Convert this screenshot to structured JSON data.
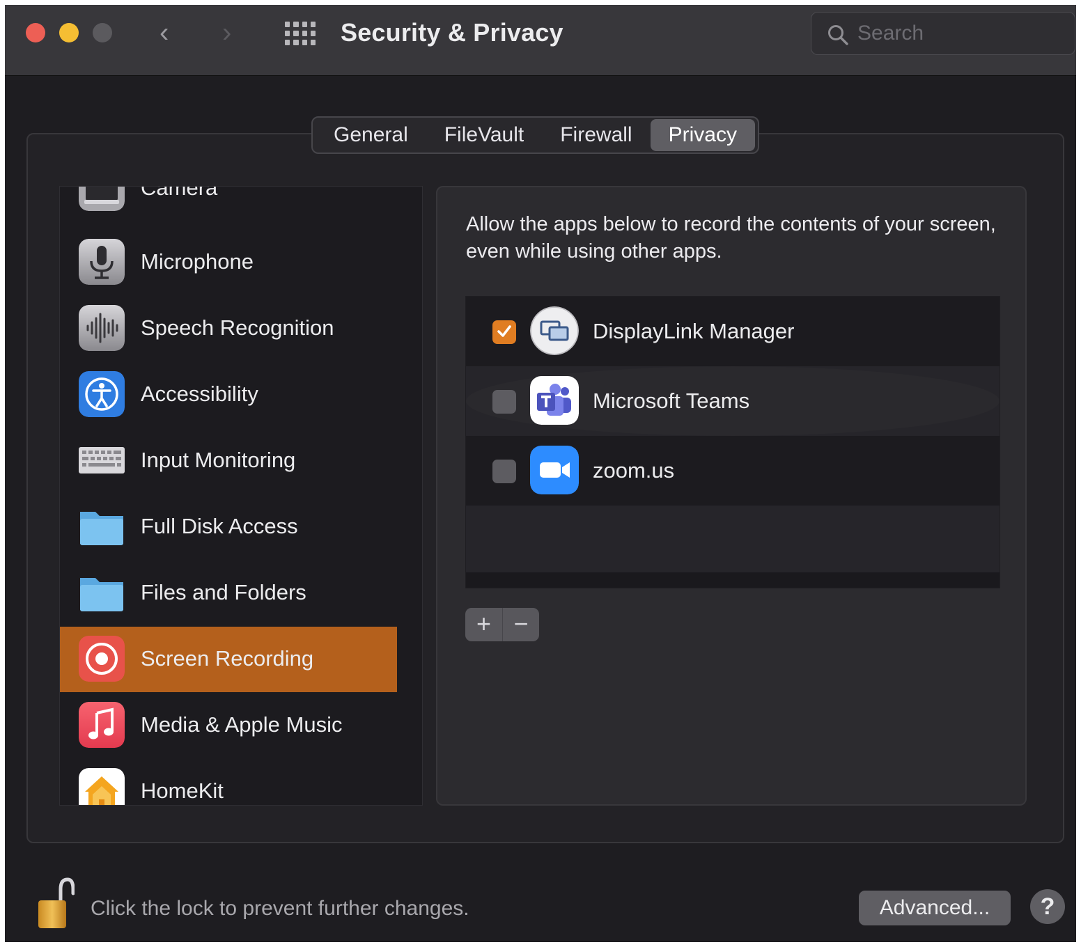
{
  "window": {
    "title": "Security & Privacy",
    "search_placeholder": "Search"
  },
  "tabs": [
    {
      "label": "General",
      "active": false
    },
    {
      "label": "FileVault",
      "active": false
    },
    {
      "label": "Firewall",
      "active": false
    },
    {
      "label": "Privacy",
      "active": true
    }
  ],
  "sidebar": {
    "items": [
      {
        "label": "Camera",
        "icon": "camera-icon"
      },
      {
        "label": "Microphone",
        "icon": "microphone-icon"
      },
      {
        "label": "Speech Recognition",
        "icon": "speech-waveform-icon"
      },
      {
        "label": "Accessibility",
        "icon": "accessibility-icon"
      },
      {
        "label": "Input Monitoring",
        "icon": "keyboard-icon"
      },
      {
        "label": "Full Disk Access",
        "icon": "folder-icon"
      },
      {
        "label": "Files and Folders",
        "icon": "folder-icon"
      },
      {
        "label": "Screen Recording",
        "icon": "screen-recording-icon",
        "selected": true
      },
      {
        "label": "Media & Apple Music",
        "icon": "music-note-icon"
      },
      {
        "label": "HomeKit",
        "icon": "home-icon"
      }
    ]
  },
  "panel": {
    "description": "Allow the apps below to record the contents of your screen, even while using other apps.",
    "apps": [
      {
        "name": "DisplayLink Manager",
        "checked": true,
        "icon": "displaylink-icon"
      },
      {
        "name": "Microsoft Teams",
        "checked": false,
        "icon": "teams-icon"
      },
      {
        "name": "zoom.us",
        "checked": false,
        "icon": "zoom-icon"
      }
    ],
    "add_label": "+",
    "remove_label": "−"
  },
  "footer": {
    "lock_text": "Click the lock to prevent further changes.",
    "advanced_label": "Advanced...",
    "help_label": "?"
  },
  "colors": {
    "accent": "#e07d22",
    "selection": "#b4601c",
    "window_bg": "#1e1d21"
  }
}
